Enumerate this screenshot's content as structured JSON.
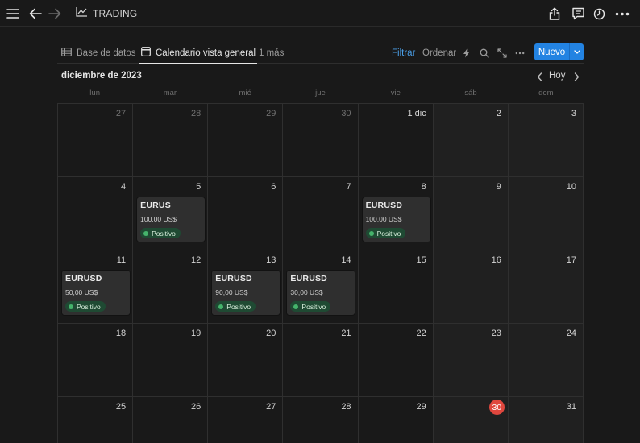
{
  "app": {
    "breadcrumb_title": "TRADING",
    "accent_color": "#2383e2",
    "today_color": "#e0473e",
    "tag_color": "#45b36b"
  },
  "views": {
    "tabs": [
      {
        "label": "Base de datos",
        "icon": "table-icon"
      },
      {
        "label": "Calendario vista general",
        "icon": "calendar-icon",
        "active": true
      },
      {
        "label": "1 más"
      }
    ],
    "filter_label": "Filtrar",
    "sort_label": "Ordenar",
    "new_label": "Nuevo"
  },
  "calendar": {
    "month_title": "diciembre de 2023",
    "today_label": "Hoy",
    "weekdays": [
      "lun",
      "mar",
      "mié",
      "jue",
      "vie",
      "sáb",
      "dom"
    ],
    "days": [
      "27",
      "28",
      "29",
      "30",
      "1 dic",
      "2",
      "3",
      "4",
      "5",
      "6",
      "7",
      "8",
      "9",
      "10",
      "11",
      "12",
      "13",
      "14",
      "15",
      "16",
      "17",
      "18",
      "19",
      "20",
      "21",
      "22",
      "23",
      "24",
      "25",
      "26",
      "27",
      "28",
      "29",
      "30",
      "31"
    ],
    "events": [
      {
        "title": "EURUS",
        "amount": "100,00 US$",
        "tag": "Positivo"
      },
      {
        "title": "EURUSD",
        "amount": "100,00 US$",
        "tag": "Positivo"
      },
      {
        "title": "EURUSD",
        "amount": "50,00 US$",
        "tag": "Positivo"
      },
      {
        "title": "EURUSD",
        "amount": "90,00 US$",
        "tag": "Positivo"
      },
      {
        "title": "EURUSD",
        "amount": "30,00 US$",
        "tag": "Positivo"
      }
    ]
  }
}
